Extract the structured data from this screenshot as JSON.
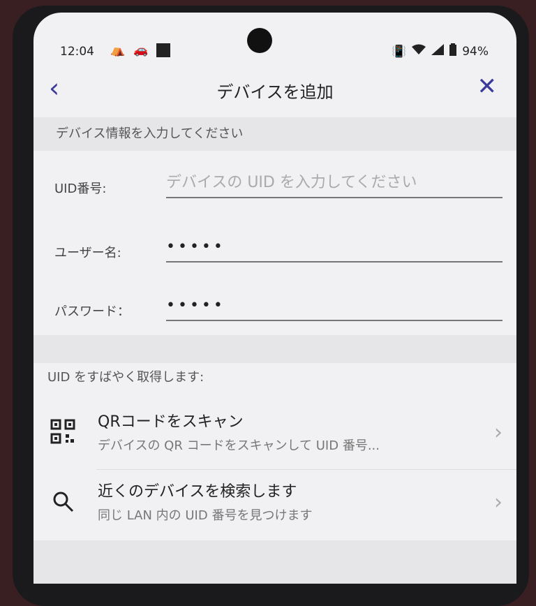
{
  "status": {
    "time": "12:04",
    "battery": "94%"
  },
  "header": {
    "title": "デバイスを追加"
  },
  "form": {
    "section_title": "デバイス情報を入力してください",
    "uid_label": "UID番号:",
    "uid_placeholder": "デバイスの UID を入力してください",
    "username_label": "ユーザー名:",
    "username_value": "•••••",
    "password_label": "パスワード：",
    "password_value": "•••••"
  },
  "quick": {
    "heading": "UID をすばやく取得します:",
    "items": [
      {
        "title": "QRコードをスキャン",
        "subtitle": "デバイスの QR コードをスキャンして UID 番号..."
      },
      {
        "title": "近くのデバイスを検索します",
        "subtitle": "同じ LAN 内の UID 番号を見つけます"
      }
    ]
  }
}
